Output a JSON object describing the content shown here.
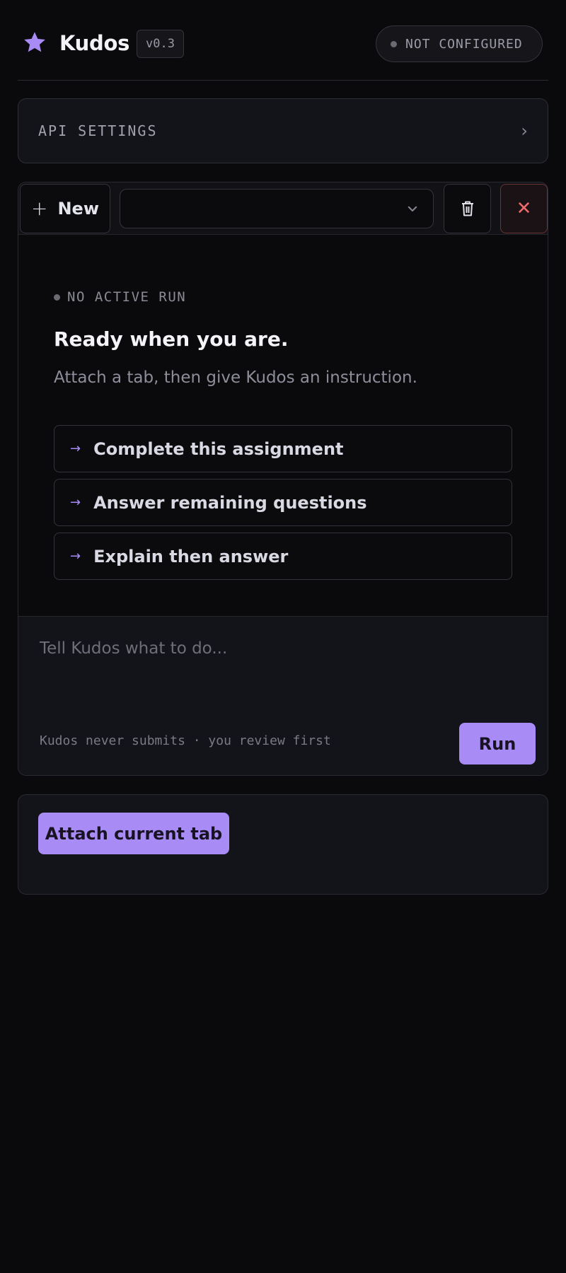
{
  "header": {
    "app_name": "Kudos",
    "version": "v0.3",
    "status": "NOT CONFIGURED"
  },
  "api_settings": {
    "label": "API SETTINGS"
  },
  "toolbar": {
    "new_label": "New",
    "tab_select_value": ""
  },
  "empty_state": {
    "run_status": "NO ACTIVE RUN",
    "title": "Ready when you are.",
    "subtitle": "Attach a tab, then give Kudos an instruction.",
    "suggestions": [
      "Complete this assignment",
      "Answer remaining questions",
      "Explain then answer"
    ]
  },
  "composer": {
    "placeholder": "Tell Kudos what to do...",
    "hint": "Kudos never submits · you review first",
    "run_label": "Run"
  },
  "attach": {
    "button_label": "Attach current tab"
  },
  "colors": {
    "accent": "#a98bf5",
    "danger": "#f06b6b",
    "background": "#0a0a0c"
  }
}
